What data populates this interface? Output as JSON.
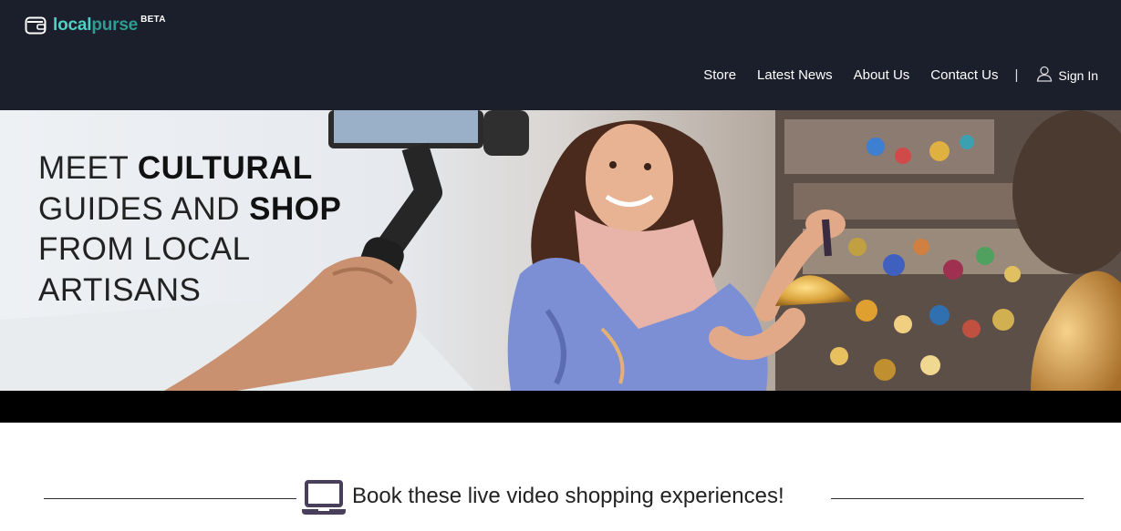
{
  "header": {
    "logo": {
      "part1": "local",
      "part2": "purse",
      "badge": "BETA",
      "icon": "wallet-icon"
    },
    "nav": {
      "items": [
        "Store",
        "Latest News",
        "About Us",
        "Contact Us"
      ],
      "separator": "|",
      "signin_label": "Sign In",
      "signin_icon": "user-icon"
    }
  },
  "hero": {
    "line1_light": "MEET ",
    "line1_bold": "CULTURAL",
    "line2_light": "GUIDES AND ",
    "line2_bold": "SHOP",
    "line3_light": "FROM LOCAL",
    "line4_light": "ARTISANS"
  },
  "section": {
    "title": "Book these live video shopping experiences!",
    "icon": "laptop-icon"
  },
  "colors": {
    "header_bg": "#1b1f2b",
    "logo_teal": "#4fd1c5",
    "text_dark": "#222222"
  }
}
